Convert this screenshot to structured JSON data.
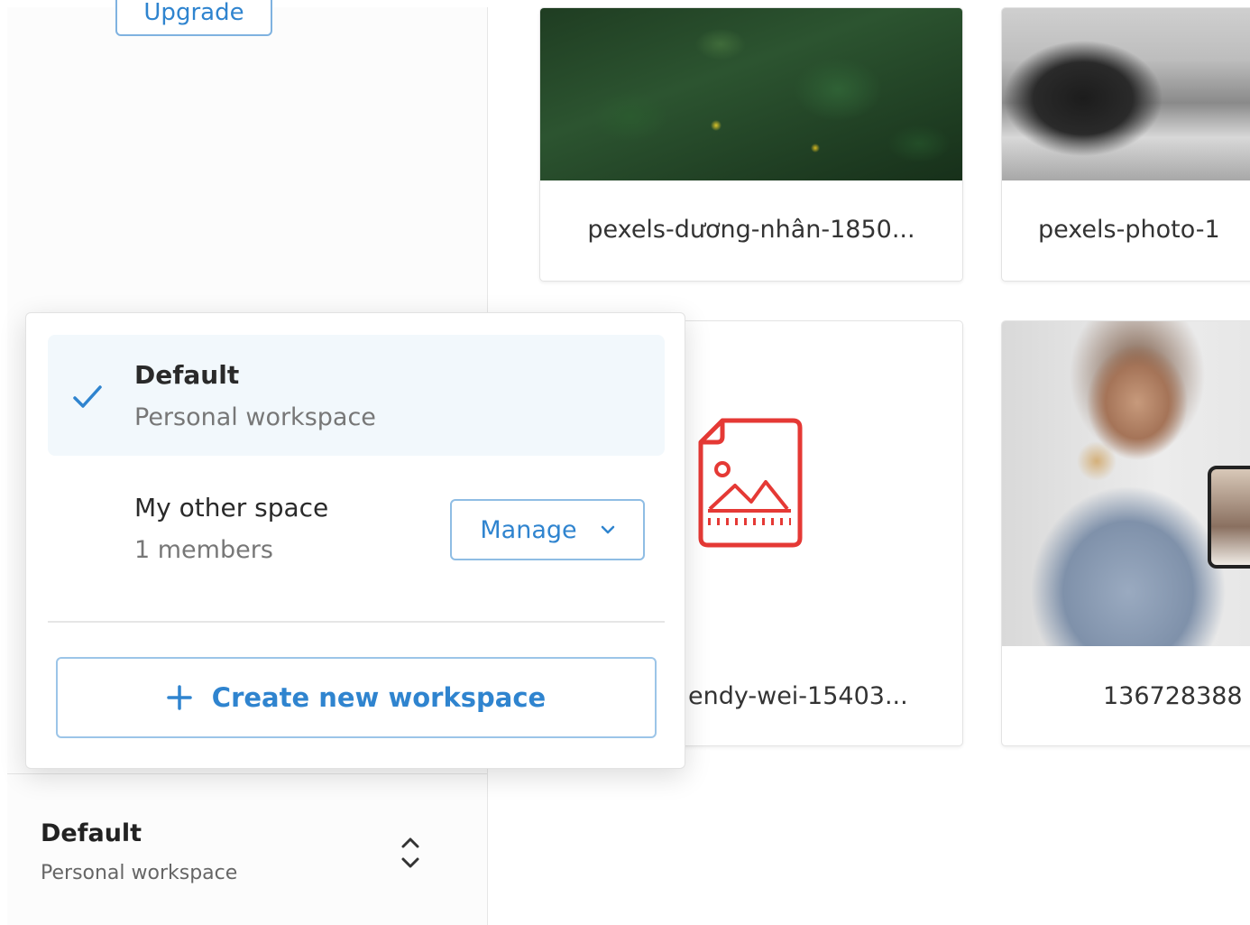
{
  "sidebar": {
    "upgrade_label": "Upgrade",
    "current_workspace": {
      "name": "Default",
      "subtitle": "Personal workspace"
    }
  },
  "files": [
    {
      "label": "pexels-dương-nhân-1850..."
    },
    {
      "label": "pexels-photo-1"
    },
    {
      "label": "endy-wei-15403..."
    },
    {
      "label": "136728388"
    }
  ],
  "workspace_menu": {
    "options": [
      {
        "name": "Default",
        "subtitle": "Personal workspace",
        "selected": true
      },
      {
        "name": "My other space",
        "subtitle": "1 members",
        "selected": false,
        "manage_label": "Manage"
      }
    ],
    "create_label": "Create new workspace"
  },
  "colors": {
    "accent": "#2f84cf",
    "selected_bg": "#f2f8fc",
    "file_icon": "#e53935"
  },
  "icons": {
    "check": "check-icon",
    "chevron_down": "chevron-down-icon",
    "plus": "plus-icon",
    "up_down": "chevron-up-down-icon",
    "image_file": "image-file-icon"
  }
}
